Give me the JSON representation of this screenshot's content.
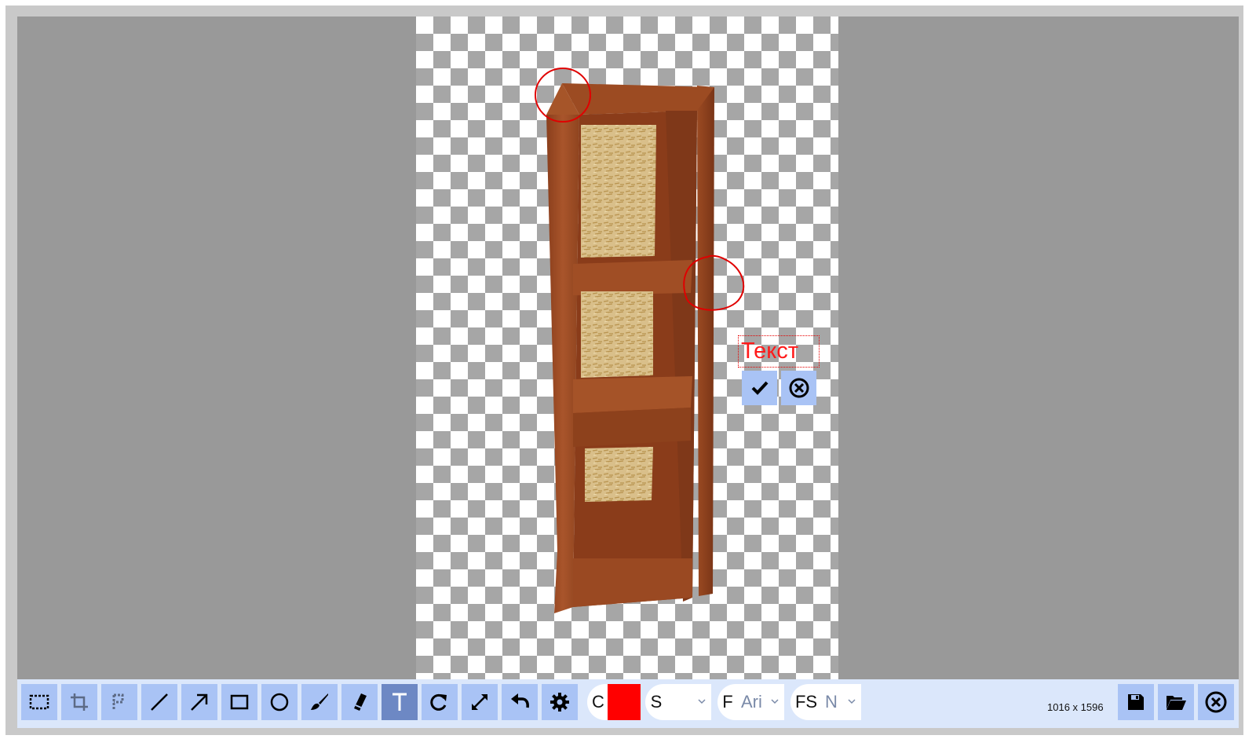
{
  "editor": {
    "text_annotation": "Текст",
    "image_size": "1016 x 1596"
  },
  "toolbar": {
    "color_label": "C",
    "color_value": "#ff0000",
    "size_label": "S",
    "size_value": "",
    "font_label": "F",
    "font_value": "Ari",
    "font_size_label": "FS",
    "font_size_value": "N"
  },
  "tools": [
    {
      "name": "select-tool-button",
      "icon": "selection-icon"
    },
    {
      "name": "crop-tool-button",
      "icon": "crop-icon"
    },
    {
      "name": "pixelate-tool-button",
      "icon": "pixelate-icon"
    },
    {
      "name": "line-tool-button",
      "icon": "line-icon"
    },
    {
      "name": "arrow-tool-button",
      "icon": "arrow-icon"
    },
    {
      "name": "rectangle-tool-button",
      "icon": "rectangle-icon"
    },
    {
      "name": "ellipse-tool-button",
      "icon": "circle-icon"
    },
    {
      "name": "brush-tool-button",
      "icon": "brush-icon"
    },
    {
      "name": "eraser-tool-button",
      "icon": "eraser-icon"
    },
    {
      "name": "text-tool-button",
      "icon": "text-icon"
    },
    {
      "name": "rotate-button",
      "icon": "redo-rotate-icon"
    },
    {
      "name": "resize-button",
      "icon": "resize-icon"
    },
    {
      "name": "undo-button",
      "icon": "undo-icon"
    },
    {
      "name": "settings-button",
      "icon": "gear-icon"
    }
  ],
  "colors": {
    "toolbar_bg": "#dbe7fb",
    "button_bg": "#a9c3f5",
    "button_active": "#6d88c4",
    "annotation": "#ff0000"
  }
}
